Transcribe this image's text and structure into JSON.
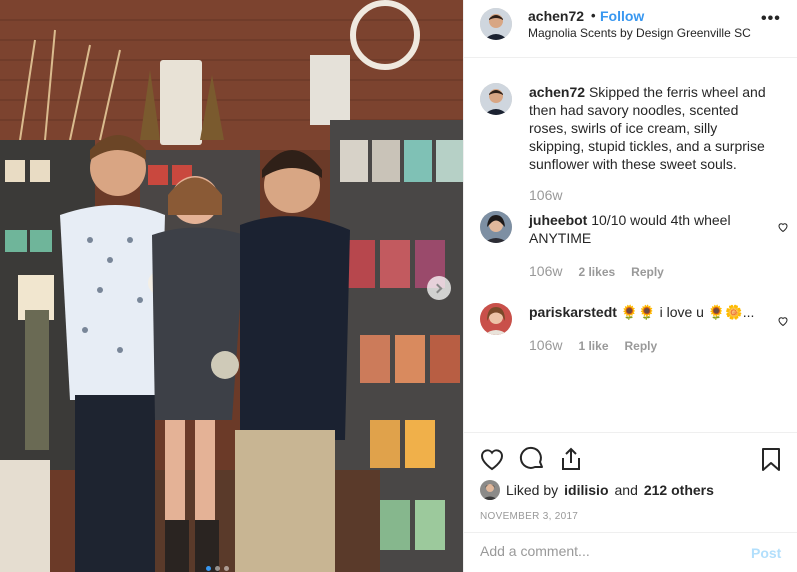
{
  "post": {
    "username": "achen72",
    "bullet": "•",
    "follow_label": "Follow",
    "location": "Magnolia Scents by Design Greenville SC",
    "more_label": "•••",
    "caption_user": "achen72",
    "caption_text": "Skipped the ferris wheel and then had savory noodles, scented roses, swirls of ice cream, silly skipping, stupid tickles, and a surprise sunflower with these sweet souls.",
    "caption_age": "106w"
  },
  "comments": [
    {
      "user": "juheebot",
      "text": "10/10 would 4th wheel ANYTIME",
      "age": "106w",
      "likes": "2 likes",
      "reply": "Reply"
    },
    {
      "user": "pariskarstedt",
      "text": "🌻🌻 i love u 🌻🌼...",
      "age": "106w",
      "likes": "1 like",
      "reply": "Reply"
    }
  ],
  "actions": {
    "liked_by_prefix": "Liked by",
    "liked_by_user": "idilisio",
    "liked_by_and": "and",
    "liked_by_count": "212 others",
    "date": "NOVEMBER 3, 2017"
  },
  "comment_input": {
    "placeholder": "Add a comment...",
    "post_label": "Post"
  },
  "carousel": {
    "total": 3,
    "active_index": 1
  },
  "icons": [
    "heart-icon",
    "comment-icon",
    "share-icon",
    "bookmark-icon",
    "more-icon",
    "chevron-right-icon"
  ],
  "colors": {
    "accent": "#3897f0",
    "post_disabled": "#b2dffc",
    "muted": "#999999",
    "border": "#efefef"
  }
}
